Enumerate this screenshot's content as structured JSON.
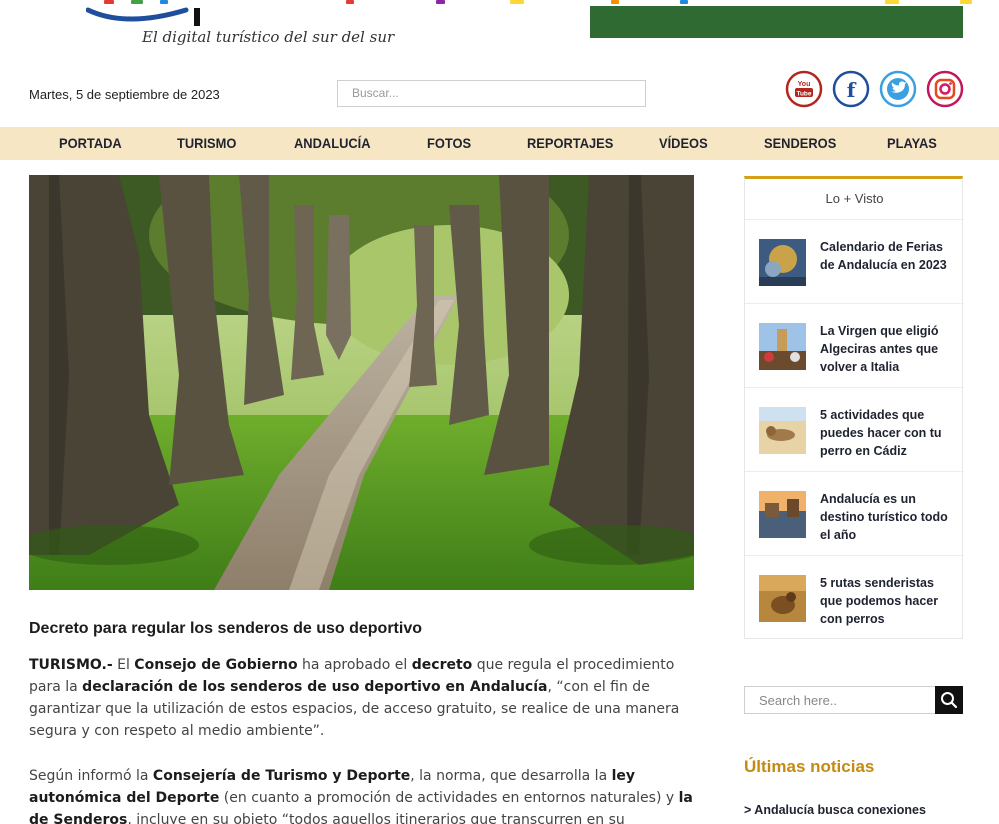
{
  "brand": {
    "tagline": "El digital turístico del sur del sur"
  },
  "header": {
    "date": "Martes, 5 de septiembre de 2023",
    "search_placeholder": "Buscar...",
    "social": [
      "youtube-icon",
      "facebook-icon",
      "twitter-icon",
      "instagram-icon"
    ],
    "youtube_label": "You Tube"
  },
  "nav": {
    "items": [
      "PORTADA",
      "TURISMO",
      "ANDALUCÍA",
      "FOTOS",
      "REPORTAJES",
      "VÍDEOS",
      "SENDEROS",
      "PLAYAS"
    ]
  },
  "article": {
    "title": "Decreto para regular los senderos de uso deportivo",
    "p1": {
      "s1": "TURISMO.-",
      "s2": " El ",
      "s3": "Consejo de Gobierno",
      "s4": " ha aprobado el ",
      "s5": "decreto",
      "s6": " que regula el procedimiento para la ",
      "s7": "declaración de los senderos de uso deportivo en Andalucía",
      "s8": ", “con el fin de garantizar que la utilización de estos espacios, de acceso gratuito, se realice de una manera segura y con respeto al medio ambiente”."
    },
    "p2": {
      "s1": "Según informó la ",
      "s2": "Consejería de Turismo y Deporte",
      "s3": ", la norma, que desarrolla la ",
      "s4": "ley autonómica del Deporte",
      "s5": " (en cuanto a promoción de actividades en entornos naturales) y ",
      "s6": "la de Senderos",
      "s7": ", incluye en su objeto “todos aquellos itinerarios que transcurren en su"
    }
  },
  "sidebar": {
    "title": "Lo + Visto",
    "items": [
      {
        "label": "Calendario de Ferias de Andalucía en 2023"
      },
      {
        "label": "La Virgen que eligió Algeciras antes que volver a Italia"
      },
      {
        "label": "5 actividades que puedes hacer con tu perro en Cádiz"
      },
      {
        "label": "Andalucía es un destino turístico todo el año"
      },
      {
        "label": "5 rutas senderistas que podemos hacer con perros"
      }
    ],
    "search_placeholder": "Search here..",
    "latest_title": "Últimas noticias",
    "latest_first": "> Andalucía busca conexiones"
  },
  "colors": {
    "nav_bg": "#f7e6c4",
    "accent_gold": "#d4a017",
    "latest_title": "#c58a12",
    "green_banner": "#2f6a32",
    "social_youtube": "#b3261e",
    "social_facebook": "#1f4e9c",
    "social_twitter": "#3aa0e0",
    "social_instagram": "#c2185b"
  }
}
